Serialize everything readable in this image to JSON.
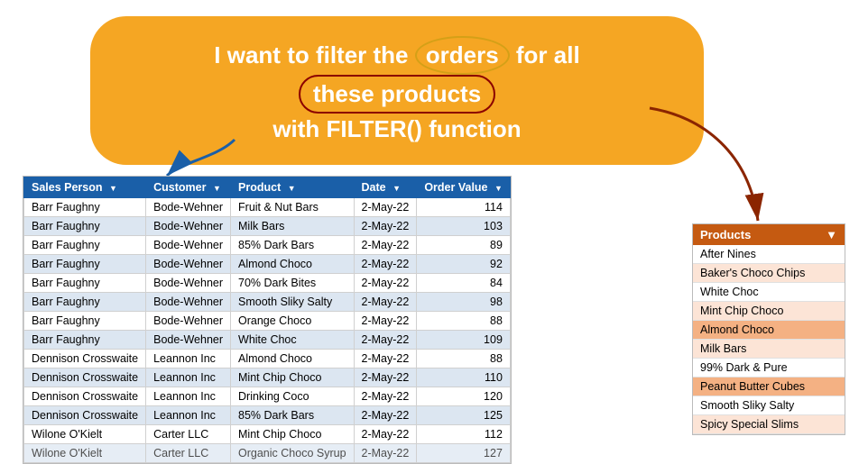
{
  "callout": {
    "line1": "I want to filter the ",
    "orders_word": "orders",
    "line1b": " for all ",
    "these_products": "these products",
    "line2": "with FILTER() function"
  },
  "table": {
    "headers": [
      "Sales Person",
      "Customer",
      "Product",
      "Date",
      "Order Value"
    ],
    "rows": [
      [
        "Barr Faughny",
        "Bode-Wehner",
        "Fruit & Nut Bars",
        "2-May-22",
        "114"
      ],
      [
        "Barr Faughny",
        "Bode-Wehner",
        "Milk Bars",
        "2-May-22",
        "103"
      ],
      [
        "Barr Faughny",
        "Bode-Wehner",
        "85% Dark Bars",
        "2-May-22",
        "89"
      ],
      [
        "Barr Faughny",
        "Bode-Wehner",
        "Almond Choco",
        "2-May-22",
        "92"
      ],
      [
        "Barr Faughny",
        "Bode-Wehner",
        "70% Dark Bites",
        "2-May-22",
        "84"
      ],
      [
        "Barr Faughny",
        "Bode-Wehner",
        "Smooth Sliky Salty",
        "2-May-22",
        "98"
      ],
      [
        "Barr Faughny",
        "Bode-Wehner",
        "Orange Choco",
        "2-May-22",
        "88"
      ],
      [
        "Barr Faughny",
        "Bode-Wehner",
        "White Choc",
        "2-May-22",
        "109"
      ],
      [
        "Dennison Crosswaite",
        "Leannon Inc",
        "Almond Choco",
        "2-May-22",
        "88"
      ],
      [
        "Dennison Crosswaite",
        "Leannon Inc",
        "Mint Chip Choco",
        "2-May-22",
        "110"
      ],
      [
        "Dennison Crosswaite",
        "Leannon Inc",
        "Drinking Coco",
        "2-May-22",
        "120"
      ],
      [
        "Dennison Crosswaite",
        "Leannon Inc",
        "85% Dark Bars",
        "2-May-22",
        "125"
      ],
      [
        "Wilone O'Kielt",
        "Carter LLC",
        "Mint Chip Choco",
        "2-May-22",
        "112"
      ],
      [
        "Wilone O'Kielt",
        "Carter LLC",
        "Organic Choco Syrup",
        "2-May-22",
        "127"
      ]
    ]
  },
  "products": {
    "header": "Products",
    "items": [
      {
        "name": "After Nines",
        "highlighted": false
      },
      {
        "name": "Baker's Choco Chips",
        "highlighted": false
      },
      {
        "name": "White Choc",
        "highlighted": false
      },
      {
        "name": "Mint Chip Choco",
        "highlighted": false
      },
      {
        "name": "Almond Choco",
        "highlighted": true
      },
      {
        "name": "Milk Bars",
        "highlighted": false
      },
      {
        "name": "99% Dark & Pure",
        "highlighted": false
      },
      {
        "name": "Peanut Butter Cubes",
        "highlighted": true
      },
      {
        "name": "Smooth Sliky Salty",
        "highlighted": false
      },
      {
        "name": "Spicy Special Slims",
        "highlighted": false
      }
    ]
  }
}
